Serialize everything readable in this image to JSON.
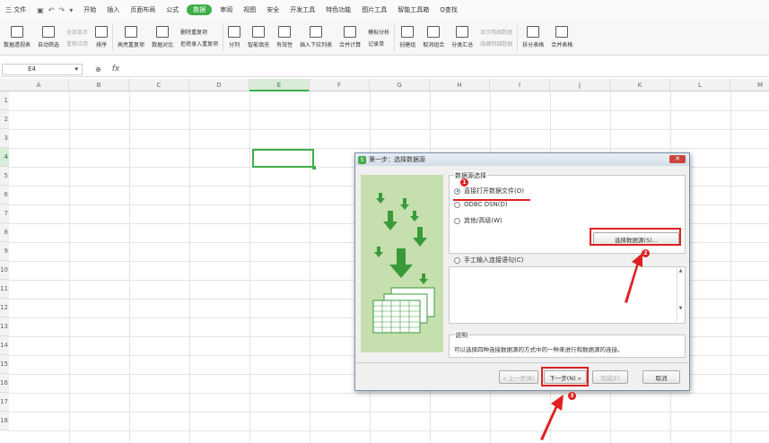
{
  "menubar": {
    "file": "三 文件",
    "items": [
      "开始",
      "插入",
      "页面布局",
      "公式",
      "数据",
      "审阅",
      "视图",
      "安全",
      "开发工具",
      "特色功能",
      "图片工具",
      "智能工具箱",
      "Q查找"
    ],
    "active_index": 4
  },
  "ribbon": {
    "pivot": "数据透视表",
    "autofilter": "自动筛选",
    "show_all": "全部显示",
    "reapply": "重新应用",
    "sort": "排序",
    "highlight_dup": "高亮重复项",
    "data_compare": "数据对比",
    "remove_dup": "删除重复项",
    "reject_dup": "拒绝录入重复项",
    "split_col": "分列",
    "smart_fill": "智能填充",
    "validity": "有效性",
    "dropdown": "插入下拉列表",
    "consolidate": "合并计算",
    "simulate": "模拟分析",
    "record": "记录单",
    "group": "创建组",
    "ungroup": "取消组合",
    "subtotal": "分类汇总",
    "show_detail": "显示明细数据",
    "hide_detail": "隐藏明细数据",
    "split_table": "拆分表格",
    "merge_table": "合并表格"
  },
  "formula_bar": {
    "cell_ref": "E4",
    "fx": "fx"
  },
  "columns": [
    "A",
    "B",
    "C",
    "D",
    "E",
    "F",
    "G",
    "H",
    "I",
    "J",
    "K",
    "L",
    "M"
  ],
  "rows": [
    "1",
    "2",
    "3",
    "4",
    "5",
    "6",
    "7",
    "8",
    "9",
    "10",
    "11",
    "12",
    "13",
    "14",
    "15",
    "16",
    "17",
    "18"
  ],
  "selected_col": "E",
  "selected_row": "4",
  "dialog": {
    "title": "第一步：选择数据源",
    "close": "✕",
    "group_label": "数据源选择",
    "opt_direct": "直接打开数据文件(O)",
    "opt_odbc": "ODBC DSN(D)",
    "opt_other": "其他/高级(W)",
    "select_source_btn": "选择数据源(S)...",
    "opt_manual": "手工输入连接语句(C)",
    "desc_label": "说明",
    "desc_text": "可以选择四种连接数据源的方式中的一种来进行和数据源的连接。",
    "prev_btn": "« 上一步(B)",
    "next_btn": "下一步(N) »",
    "finish_btn": "完成(F)",
    "cancel_btn": "取消"
  },
  "annotations": {
    "b1": "1",
    "b2": "2",
    "b3": "3"
  },
  "colors": {
    "accent": "#3fae49",
    "highlight": "#e02020"
  }
}
